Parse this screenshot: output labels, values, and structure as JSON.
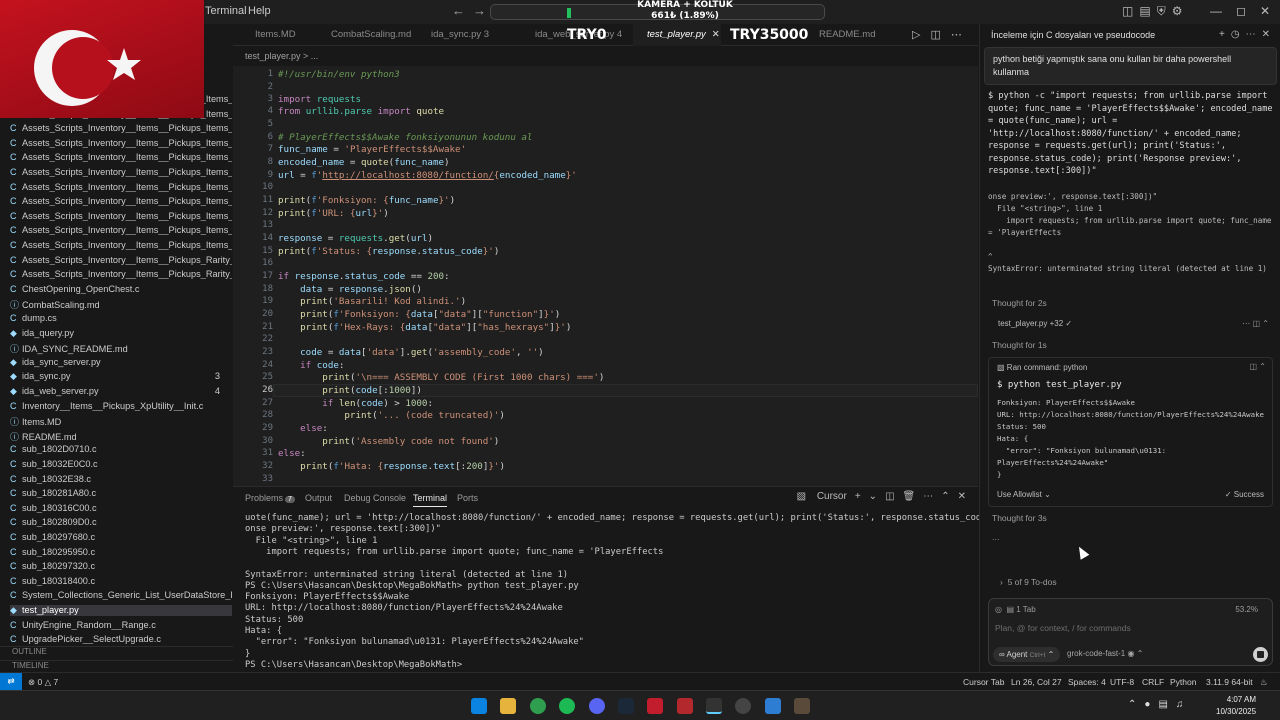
{
  "titlebar": {
    "menu_terminal": "Terminal",
    "menu_help": "Help",
    "ticker_name": "KAMERA + KOLTUK",
    "ticker_value": "661₺ (1.89%)",
    "tag_left": "TRY0",
    "tag_right": "TRY35000"
  },
  "tabs": [
    {
      "label": "Items.MD"
    },
    {
      "label": "CombatScaling.md"
    },
    {
      "label": "ida_sync.py 3"
    },
    {
      "label": "ida_web_server.py 4"
    },
    {
      "label": "test_player.py"
    },
    {
      "label": "README.md"
    }
  ],
  "breadcrumb": "test_player.py  >  ...",
  "explorer": {
    "files": [
      {
        "name": "Assets_Scripts_Inventory__Items__Pickups_Items_Item...",
        "count": ""
      },
      {
        "name": "Assets_Scripts_Inventory__Items__Pickups_Items_Item...",
        "count": ""
      },
      {
        "name": "Assets_Scripts_Inventory__Items__Pickups_Items_Item...",
        "count": ""
      },
      {
        "name": "Assets_Scripts_Inventory__Items__Pickups_Items_Item...",
        "count": ""
      },
      {
        "name": "Assets_Scripts_Inventory__Items__Pickups_Items_Item...",
        "count": ""
      },
      {
        "name": "Assets_Scripts_Inventory__Items__Pickups_Items_Item...",
        "count": ""
      },
      {
        "name": "Assets_Scripts_Inventory__Items__Pickups_Items_Item...",
        "count": ""
      },
      {
        "name": "Assets_Scripts_Inventory__Items__Pickups_Items_Item...",
        "count": ""
      },
      {
        "name": "Assets_Scripts_Inventory__Items__Pickups_Items_Item...",
        "count": ""
      },
      {
        "name": "Assets_Scripts_Inventory__Items__Pickups_Items_Item...",
        "count": ""
      },
      {
        "name": "Assets_Scripts_Inventory__Items__Pickups_Items_Item...",
        "count": ""
      },
      {
        "name": "Assets_Scripts_Inventory__Items__Pickups_Rarity__Cal...",
        "count": ""
      },
      {
        "name": "Assets_Scripts_Inventory__Items__Pickups_Rarity__Ge...",
        "count": ""
      },
      {
        "name": "ChestOpening_OpenChest.c",
        "count": ""
      },
      {
        "name": "CombatScaling.md",
        "count": ""
      },
      {
        "name": "dump.cs",
        "count": ""
      },
      {
        "name": "ida_query.py",
        "count": ""
      },
      {
        "name": "IDA_SYNC_README.md",
        "count": ""
      },
      {
        "name": "ida_sync_server.py",
        "count": ""
      },
      {
        "name": "ida_sync.py",
        "count": "3"
      },
      {
        "name": "ida_web_server.py",
        "count": "4"
      },
      {
        "name": "Inventory__Items__Pickups_XpUtility__Init.c",
        "count": ""
      },
      {
        "name": "Items.MD",
        "count": ""
      },
      {
        "name": "README.md",
        "count": ""
      },
      {
        "name": "sub_1802D0710.c",
        "count": ""
      },
      {
        "name": "sub_18032E0C0.c",
        "count": ""
      },
      {
        "name": "sub_18032E38.c",
        "count": ""
      },
      {
        "name": "sub_180281A80.c",
        "count": ""
      },
      {
        "name": "sub_180316C00.c",
        "count": ""
      },
      {
        "name": "sub_1802809D0.c",
        "count": ""
      },
      {
        "name": "sub_180297680.c",
        "count": ""
      },
      {
        "name": "sub_180295950.c",
        "count": ""
      },
      {
        "name": "sub_180297320.c",
        "count": ""
      },
      {
        "name": "sub_180318400.c",
        "count": ""
      },
      {
        "name": "System_Collections_Generic_List_UserDataStore_Play...",
        "count": ""
      },
      {
        "name": "test_player.py",
        "count": ""
      },
      {
        "name": "UnityEngine_Random__Range.c",
        "count": ""
      },
      {
        "name": "UpgradePicker__SelectUpgrade.c",
        "count": ""
      }
    ],
    "outline": "OUTLINE",
    "timeline": "TIMELINE"
  },
  "panel": {
    "tabs": [
      "Problems",
      "Output",
      "Debug Console",
      "Terminal",
      "Ports"
    ],
    "problems_count": "7",
    "shell": "Cursor",
    "terminal_lines": [
      "uote(func_name); url = 'http://localhost:8080/function/' + encoded_name; response = requests.get(url); print('Status:', response.status_code); print('Resp",
      "onse preview:', response.text[:300])\"",
      "  File \"<string>\", line 1",
      "    import requests; from urllib.parse import quote; func_name = 'PlayerEffects",
      "",
      "SyntaxError: unterminated string literal (detected at line 1)",
      "PS C:\\Users\\Hasancan\\Desktop\\MegaBokMath> python test_player.py",
      "Fonksiyon: PlayerEffects$$Awake",
      "URL: http://localhost:8080/function/PlayerEffects%24%24Awake",
      "Status: 500",
      "Hata: {",
      "  \"error\": \"Fonksiyon bulunamad\\u0131: PlayerEffects%24%24Awake\"",
      "}",
      "PS C:\\Users\\Hasancan\\Desktop\\MegaBokMath> "
    ]
  },
  "chat": {
    "title": "İnceleme için C dosyaları ve pseudocode",
    "user_message": "python betiği yapmıştık sana onu kullan bir daha powershell kullanma",
    "cmd_block": "$ python -c \"import requests; from urllib.parse import quote; func_name = 'PlayerEffects$$Awake'; encoded_name = quote(func_name); url = 'http://localhost:8080/function/' + encoded_name; response = requests.get(url); print('Status:', response.status_code); print('Response preview:', response.text[:300])\"",
    "cmd_output": "onse preview:', response.text[:300])\"\n  File \"<string>\", line 1\n    import requests; from urllib.parse import quote; func_name = 'PlayerEffects\n\n^\nSyntaxError: unterminated string literal (detected at line 1)",
    "thought1": "Thought for 2s",
    "file_row": "test_player.py +32 ✓",
    "thought2": "Thought for 1s",
    "run_label": "Ran command: python",
    "run_cmd": "$ python test_player.py",
    "run_output": "Fonksiyon: PlayerEffects$$Awake\nURL: http://localhost:8080/function/PlayerEffects%24%24Awake\nStatus: 500\nHata: {\n  \"error\": \"Fonksiyon bulunamad\\u0131: PlayerEffects%24%24Awake\"\n}",
    "allowlist": "Use Allowlist",
    "success": "Success",
    "thought3": "Thought for 3s",
    "dots": "...",
    "todos": "5 of 9 To-dos",
    "tab_info": "1 Tab",
    "context_pct": "53.2%",
    "placeholder": "Plan, @ for context, / for commands",
    "agent_label": "Agent",
    "agent_shortcut": "Ctrl+I",
    "model": "grok-code-fast-1"
  },
  "statusbar": {
    "problems": "0",
    "warnings": "7",
    "cursor_tab": "Cursor Tab",
    "position": "Ln 26, Col 27",
    "spaces": "Spaces: 4",
    "encoding": "UTF-8",
    "eol": "CRLF",
    "language": "Python",
    "interpreter": "3.11.9 64-bit"
  },
  "taskbar": {
    "time": "4:07 AM",
    "date": "10/30/2025"
  },
  "colors": {
    "accent": "#0078d4",
    "flag_red": "#c4121f",
    "progress_green": "#21c25e"
  }
}
